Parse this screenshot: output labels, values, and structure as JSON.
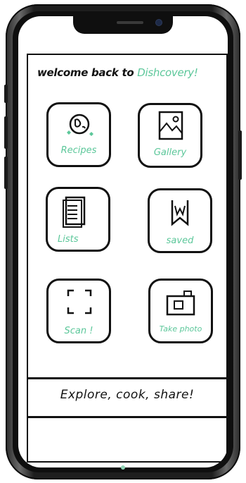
{
  "app": {
    "welcome_prefix": "welcome back to",
    "brand_name": "Dishcovery!",
    "tagline": "Explore, cook, share!",
    "accent_color": "#5cc79a"
  },
  "tiles": [
    {
      "label": "Recipes",
      "icon": "globe-icon"
    },
    {
      "label": "Gallery",
      "icon": "image-icon"
    },
    {
      "label": "Lists",
      "icon": "list-icon"
    },
    {
      "label": "saved",
      "icon": "bookmark-icon"
    },
    {
      "label": "Scan !",
      "icon": "scan-icon"
    },
    {
      "label": "Take photo",
      "icon": "camera-icon"
    }
  ]
}
